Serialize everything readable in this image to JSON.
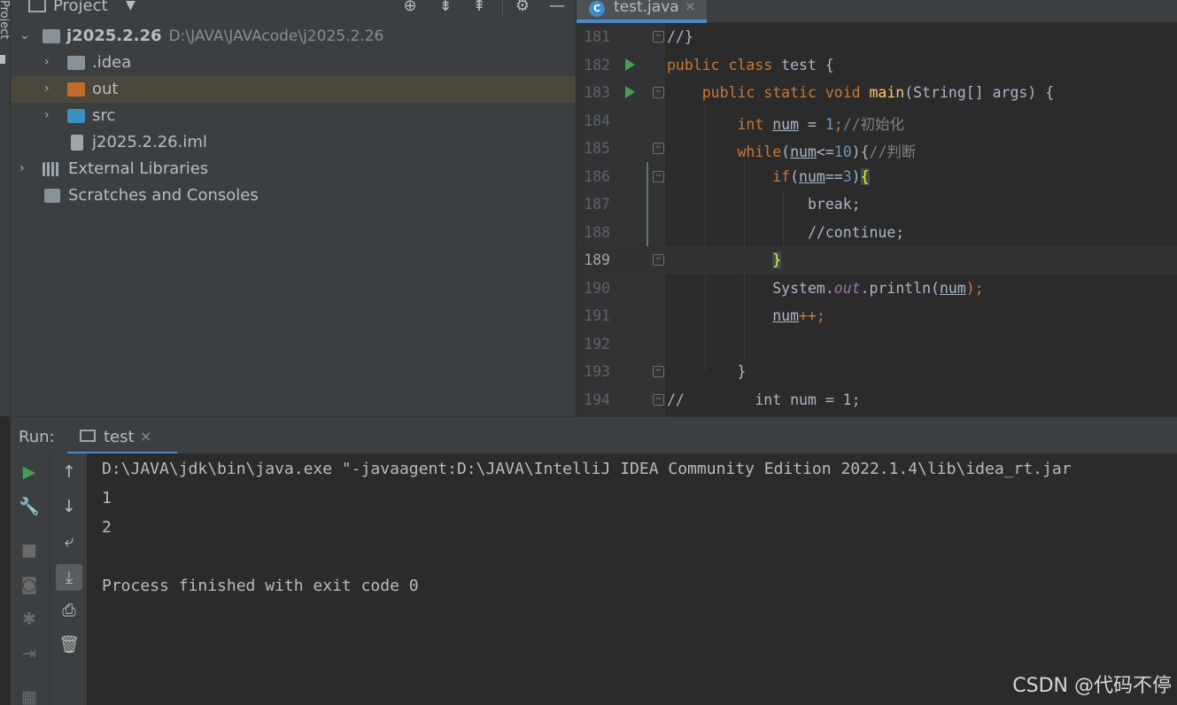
{
  "side_strip": {
    "label": "Project"
  },
  "project": {
    "title": "Project",
    "tree": [
      {
        "label": "j2025.2.26",
        "path": "D:\\JAVA\\JAVAcode\\j2025.2.26"
      },
      {
        "label": ".idea"
      },
      {
        "label": "out"
      },
      {
        "label": "src"
      },
      {
        "label": "j2025.2.26.iml"
      },
      {
        "label": "External Libraries"
      },
      {
        "label": "Scratches and Consoles"
      }
    ],
    "colors": {
      "idea_folder": "#87939a",
      "out_folder": "#c26b2c",
      "src_folder": "#3c8fbf"
    }
  },
  "editor": {
    "tab": {
      "label": "test.java",
      "close": "×",
      "icon_letter": "C"
    },
    "lines": [
      {
        "n": "181"
      },
      {
        "n": "182"
      },
      {
        "n": "183"
      },
      {
        "n": "184"
      },
      {
        "n": "185"
      },
      {
        "n": "186"
      },
      {
        "n": "187"
      },
      {
        "n": "188"
      },
      {
        "n": "189"
      },
      {
        "n": "190"
      },
      {
        "n": "191"
      },
      {
        "n": "192"
      },
      {
        "n": "193"
      },
      {
        "n": "194"
      }
    ],
    "code": {
      "l181": "//}",
      "l182_kw": "public class ",
      "l182_name": "test {",
      "l183_kw": "public static void ",
      "l183_fn": "main",
      "l183_rest": "(String[] args) {",
      "l184_kw": "int ",
      "l184_var": "num",
      "l184_eq": " = ",
      "l184_num": "1",
      "l184_semi": ";",
      "l184_cm": "//初始化",
      "l185_kw": "while",
      "l185_open": "(",
      "l185_var": "num",
      "l185_op": "<=",
      "l185_num": "10",
      "l185_close": "){",
      "l185_cm": "//判断",
      "l186_kw": "if",
      "l186_open": "(",
      "l186_var": "num",
      "l186_op": "==",
      "l186_num": "3",
      "l186_close": ")",
      "l186_brace": "{",
      "l187": "break;",
      "l188": "//continue;",
      "l189": "}",
      "l190_a": "System.",
      "l190_b": "out",
      "l190_c": ".println(",
      "l190_d": "num",
      "l190_e": ");",
      "l191_var": "num",
      "l191_rest": "++;",
      "l192": "",
      "l193": "}",
      "l194_cm": "//",
      "l194_rest": "        int num = 1;"
    }
  },
  "run": {
    "label": "Run:",
    "tab": {
      "label": "test",
      "close": "×"
    },
    "output": [
      "D:\\JAVA\\jdk\\bin\\java.exe \"-javaagent:D:\\JAVA\\IntelliJ IDEA Community Edition 2022.1.4\\lib\\idea_rt.jar",
      "1",
      "2",
      "",
      "Process finished with exit code 0"
    ]
  },
  "watermark": "CSDN @代码不停"
}
